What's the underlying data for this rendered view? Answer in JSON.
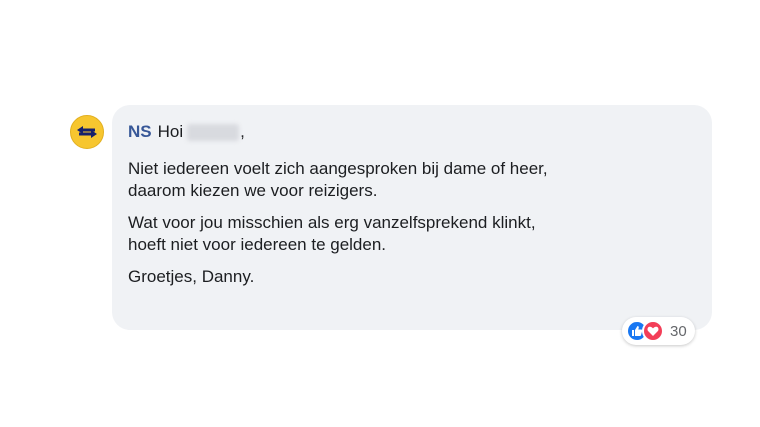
{
  "comment": {
    "author": "NS",
    "greeting": "Hoi",
    "redacted_name": "",
    "greeting_suffix": ",",
    "paragraphs": [
      [
        "Niet iedereen voelt zich aangesproken bij dame of heer,",
        "daarom kiezen we voor reizigers."
      ],
      [
        "Wat voor jou misschien als erg vanzelfsprekend klinkt,",
        "hoeft niet voor iedereen te gelden."
      ],
      [
        "Groetjes, Danny."
      ]
    ]
  },
  "reactions": {
    "icons": [
      "like-icon",
      "love-icon"
    ],
    "count": "30"
  },
  "colors": {
    "author": "#385898",
    "bubble": "#f0f2f5",
    "avatar": "#f7c62f",
    "like": "#1877f2",
    "love": "#f33e58"
  }
}
